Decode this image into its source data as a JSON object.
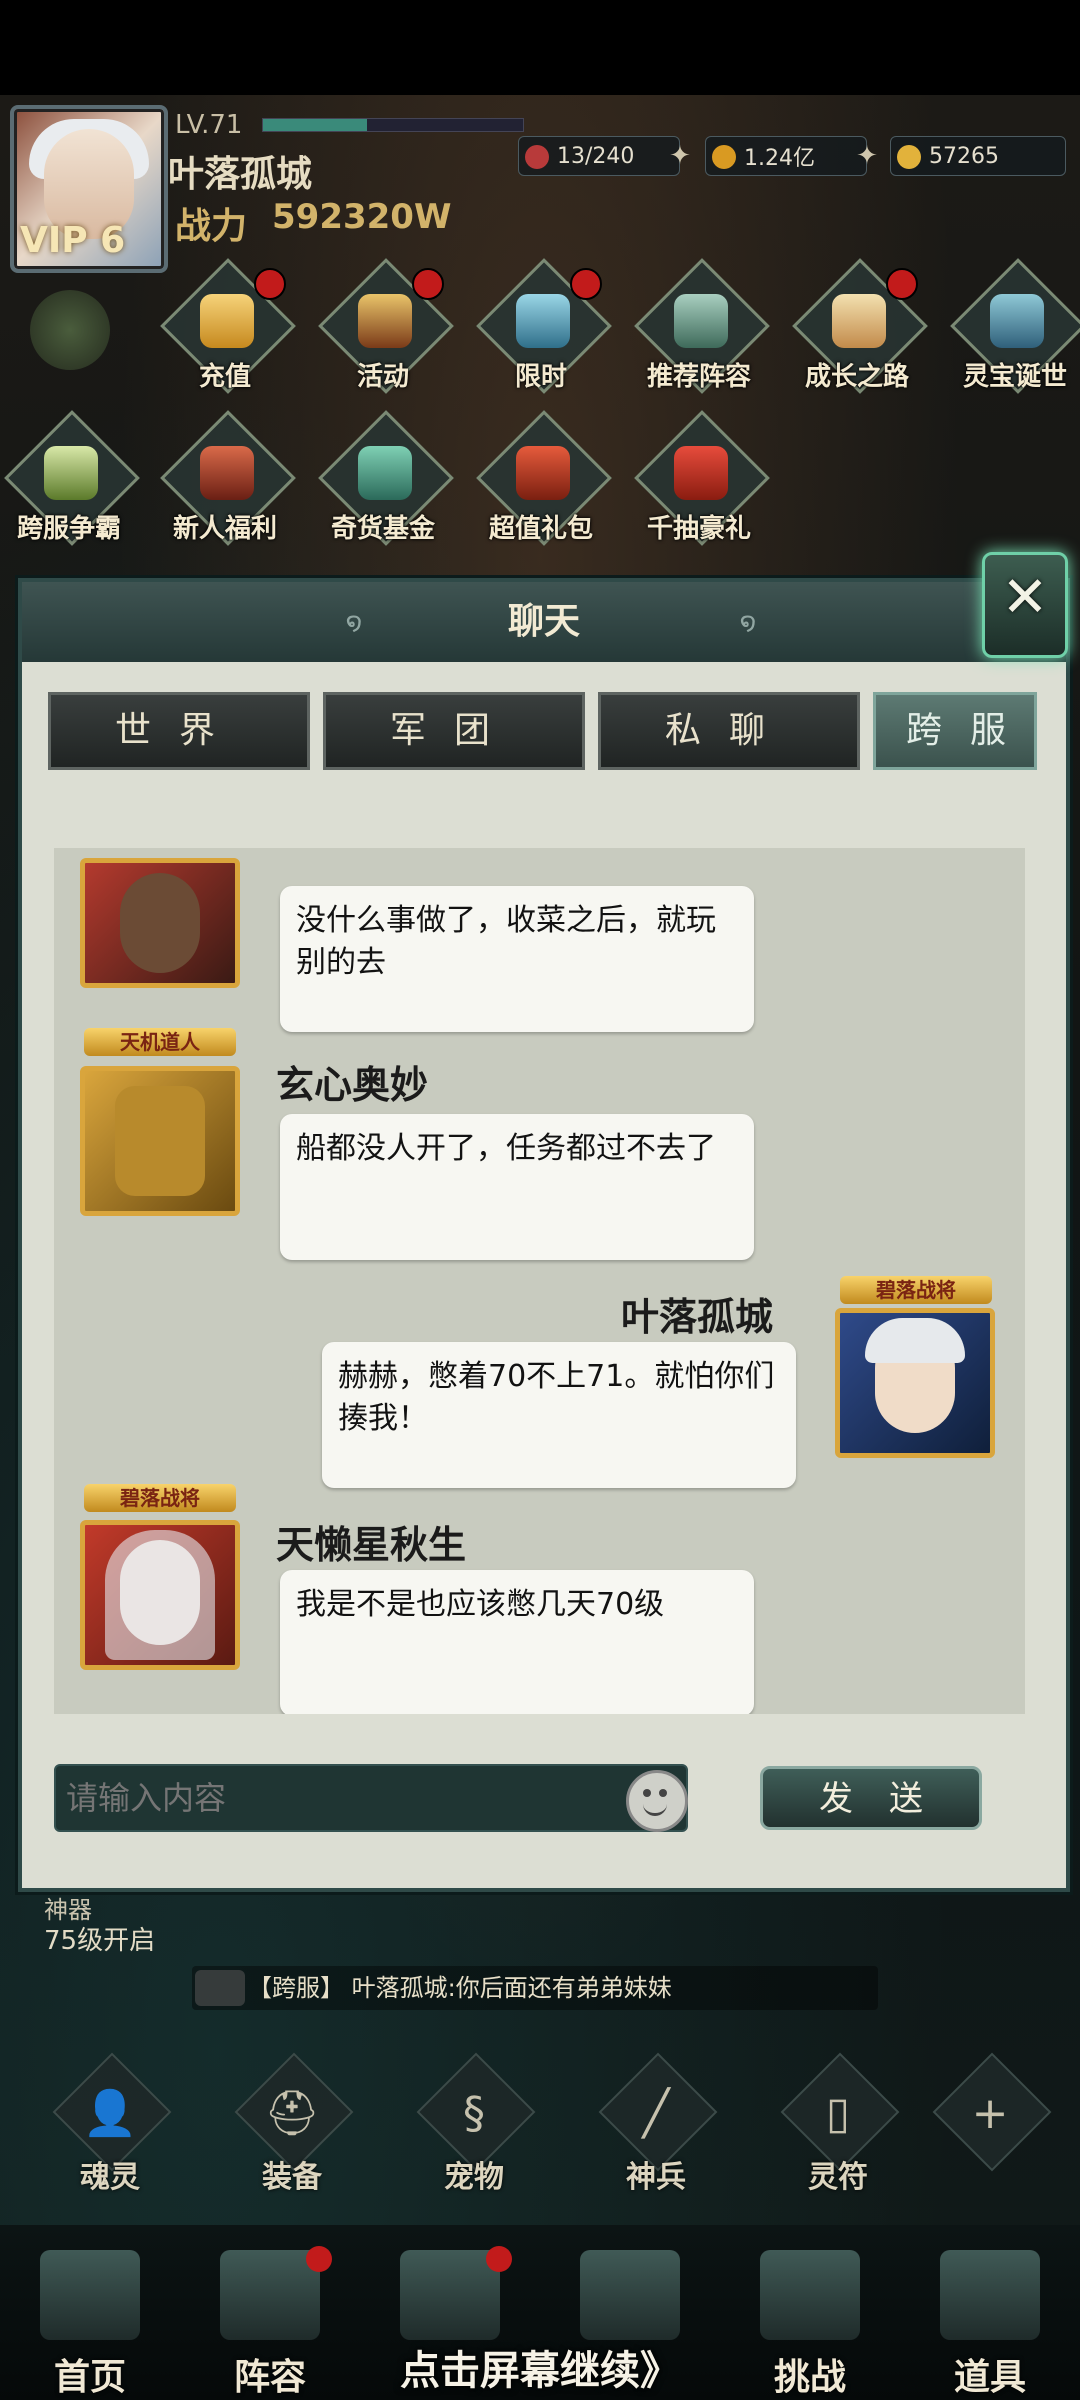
{
  "player": {
    "level": "LV.71",
    "level_progress": 0.4,
    "name": "叶落孤城",
    "power_label": "战力",
    "power_value": "592320W",
    "vip": "VIP 6"
  },
  "resources": [
    {
      "name": "stamina",
      "value": "13/240",
      "icon": "red-gem-icon",
      "color": "#b83a3a"
    },
    {
      "name": "coins",
      "value": "1.24亿",
      "icon": "gold-coin-icon",
      "color": "#d99a22"
    },
    {
      "name": "ingots",
      "value": "57265",
      "icon": "gold-ingot-icon",
      "color": "#e2b23b"
    }
  ],
  "activities_row1": [
    {
      "label": "充值",
      "badge": true
    },
    {
      "label": "活动",
      "badge": true
    },
    {
      "label": "限时",
      "badge": true
    },
    {
      "label": "推荐阵容",
      "badge": false
    },
    {
      "label": "成长之路",
      "badge": true
    },
    {
      "label": "灵宝诞世",
      "badge": false
    }
  ],
  "activities_row2": [
    {
      "label": "跨服争霸"
    },
    {
      "label": "新人福利"
    },
    {
      "label": "奇货基金"
    },
    {
      "label": "超值礼包"
    },
    {
      "label": "千抽豪礼"
    }
  ],
  "chat": {
    "title": "聊天",
    "tabs": [
      "世界",
      "军团",
      "私聊",
      "跨服"
    ],
    "active_tab": "跨服",
    "messages": [
      {
        "author": "",
        "badge": "",
        "text": "没什么事做了，收菜之后，就玩别的去",
        "side": "left"
      },
      {
        "author": "玄心奥妙",
        "badge": "天机道人",
        "text": "船都没人开了，任务都过不去了",
        "side": "left"
      },
      {
        "author": "叶落孤城",
        "badge": "碧落战将",
        "text": "赫赫，憋着70不上71。就怕你们揍我！",
        "side": "right"
      },
      {
        "author": "天懒星秋生",
        "badge": "碧落战将",
        "text": "我是不是也应该憋几天70级",
        "side": "left"
      }
    ],
    "input_placeholder": "请输入内容",
    "send_label": "发送"
  },
  "below": {
    "shenqi_label": "神器",
    "shenqi_unlock": "75级开启",
    "ticker": "【跨服】 叶落孤城:你后面还有弟弟妹妹"
  },
  "features": [
    {
      "label": "魂灵",
      "icon": "soul-icon"
    },
    {
      "label": "装备",
      "icon": "helmet-icon"
    },
    {
      "label": "宠物",
      "icon": "pet-icon"
    },
    {
      "label": "神兵",
      "icon": "sword-icon"
    },
    {
      "label": "灵符",
      "icon": "talisman-icon"
    },
    {
      "label": "",
      "icon": "plus-icon"
    }
  ],
  "nav": [
    {
      "label": "首页",
      "badge": false
    },
    {
      "label": "阵容",
      "badge": true
    },
    {
      "label": "",
      "badge": true
    },
    {
      "label": "",
      "badge": false
    },
    {
      "label": "挑战",
      "badge": false
    },
    {
      "label": "道具",
      "badge": false
    }
  ],
  "continue_text": "点击屏幕继续》"
}
